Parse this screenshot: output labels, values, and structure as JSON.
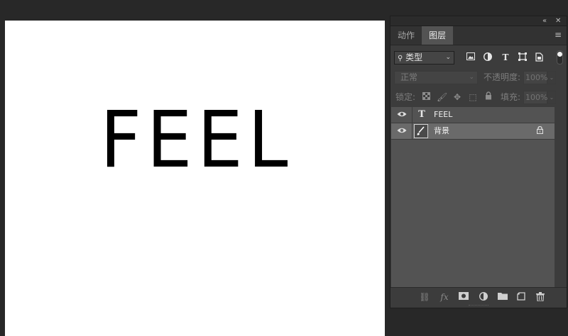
{
  "canvas": {
    "text_layer_content": "FEEL"
  },
  "panel": {
    "tabs": [
      {
        "label": "动作"
      },
      {
        "label": "图层"
      }
    ],
    "filter": {
      "selected": "类型",
      "icons": [
        "image-filter-icon",
        "adjustment-filter-icon",
        "text-filter-icon",
        "shape-filter-icon",
        "smart-object-filter-icon"
      ]
    },
    "blend": {
      "mode": "正常",
      "opacity_label": "不透明度:",
      "opacity_value": "100%"
    },
    "lock": {
      "label": "锁定:",
      "fill_label": "填充:",
      "fill_value": "100%"
    },
    "layers": [
      {
        "name": "FEEL",
        "type": "text",
        "selected": false,
        "locked": false
      },
      {
        "name": "背景",
        "type": "image",
        "selected": true,
        "locked": true
      }
    ]
  },
  "colors": {
    "workspace_bg": "#282828",
    "panel_bg": "#3c3c3c",
    "layers_bg": "#535353",
    "selected_layer": "#6a6a6a",
    "canvas_bg": "#ffffff"
  }
}
